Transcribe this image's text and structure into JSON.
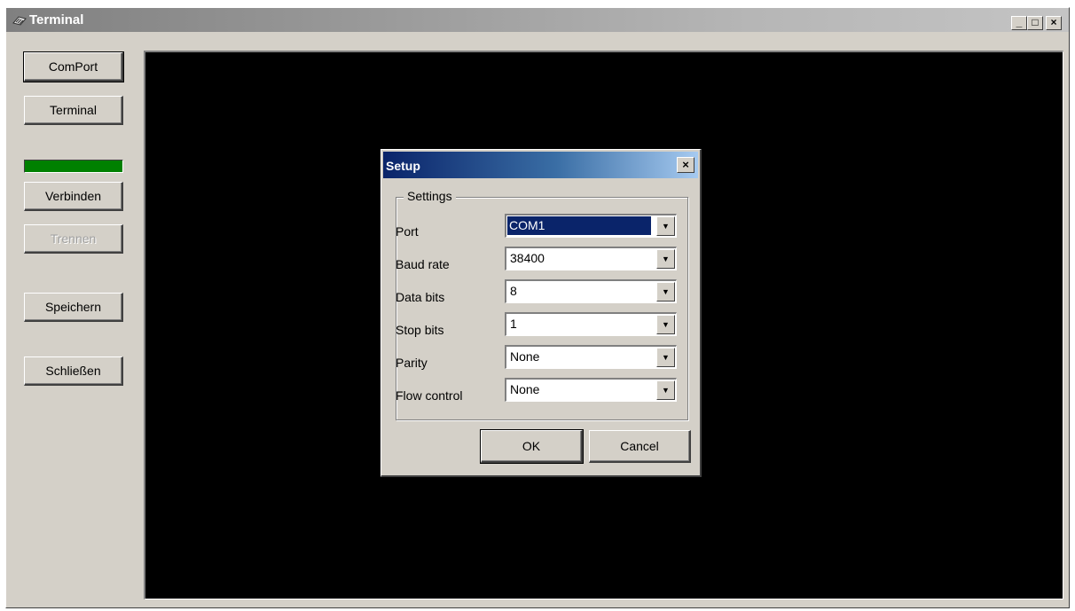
{
  "window": {
    "title": "Terminal",
    "caption_buttons": {
      "minimize": "_",
      "maximize": "□",
      "close": "×"
    }
  },
  "sidebar": {
    "buttons": [
      {
        "label": "ComPort",
        "enabled": true,
        "default": true
      },
      {
        "label": "Terminal",
        "enabled": true
      },
      {
        "label": "Verbinden",
        "enabled": true
      },
      {
        "label": "Trennen",
        "enabled": false
      },
      {
        "label": "Speichern",
        "enabled": true
      },
      {
        "label": "Schließen",
        "enabled": true
      }
    ],
    "status_led_color": "#008000"
  },
  "dialog": {
    "title": "Setup",
    "close_glyph": "×",
    "group_title": "Settings",
    "fields": [
      {
        "label": "Port",
        "value": "COM1",
        "selected": true
      },
      {
        "label": "Baud rate",
        "value": "38400"
      },
      {
        "label": "Data bits",
        "value": "8"
      },
      {
        "label": "Stop bits",
        "value": "1"
      },
      {
        "label": "Parity",
        "value": "None"
      },
      {
        "label": "Flow control",
        "value": "None"
      }
    ],
    "ok_label": "OK",
    "cancel_label": "Cancel"
  },
  "colors": {
    "terminal_background": "#000000",
    "dialog_titlebar": "#0a246a",
    "selection": "#0a246a"
  }
}
